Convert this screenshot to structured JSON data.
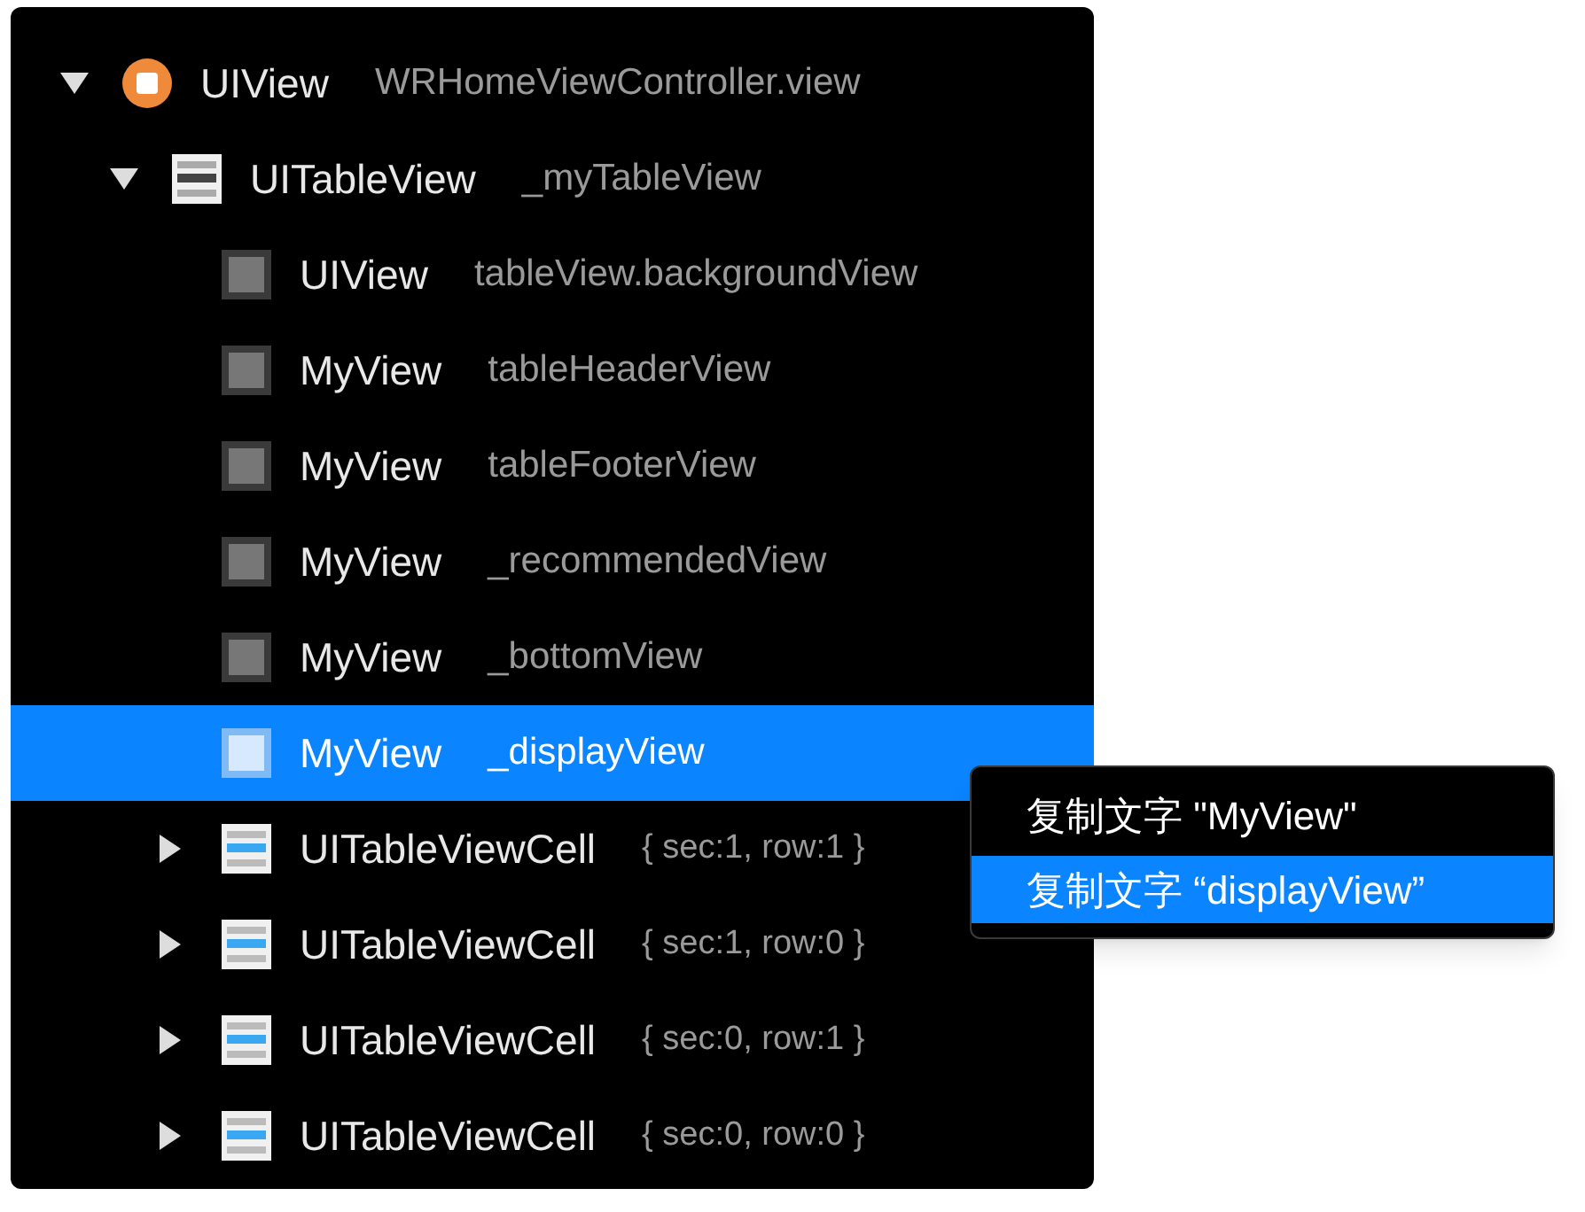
{
  "tree": [
    {
      "name": "UIView",
      "detail": "WRHomeViewController.view",
      "kind": "root_view",
      "expanded": true,
      "selected": false,
      "children": [
        {
          "name": "UITableView",
          "detail": "_myTableView",
          "kind": "table",
          "expanded": true,
          "selected": false,
          "children": [
            {
              "name": "UIView",
              "detail": "tableView.backgroundView",
              "kind": "view",
              "selected": false
            },
            {
              "name": "MyView",
              "detail": "tableHeaderView",
              "kind": "view",
              "selected": false
            },
            {
              "name": "MyView",
              "detail": "tableFooterView",
              "kind": "view",
              "selected": false
            },
            {
              "name": "MyView",
              "detail": "_recommendedView",
              "kind": "view",
              "selected": false
            },
            {
              "name": "MyView",
              "detail": "_bottomView",
              "kind": "view",
              "selected": false
            },
            {
              "name": "MyView",
              "detail": "_displayView",
              "kind": "view",
              "selected": true
            },
            {
              "name": "UITableViewCell",
              "detail": "{ sec:1, row:1 }",
              "kind": "cell",
              "expanded": false,
              "selected": false
            },
            {
              "name": "UITableViewCell",
              "detail": "{ sec:1, row:0 }",
              "kind": "cell",
              "expanded": false,
              "selected": false
            },
            {
              "name": "UITableViewCell",
              "detail": "{ sec:0, row:1 }",
              "kind": "cell",
              "expanded": false,
              "selected": false
            },
            {
              "name": "UITableViewCell",
              "detail": "{ sec:0, row:0 }",
              "kind": "cell",
              "expanded": false,
              "selected": false
            }
          ]
        }
      ]
    }
  ],
  "context_menu": {
    "items": [
      {
        "label": "复制文字 \"MyView\"",
        "selected": false
      },
      {
        "label": "复制文字 “displayView”",
        "selected": true
      }
    ]
  }
}
